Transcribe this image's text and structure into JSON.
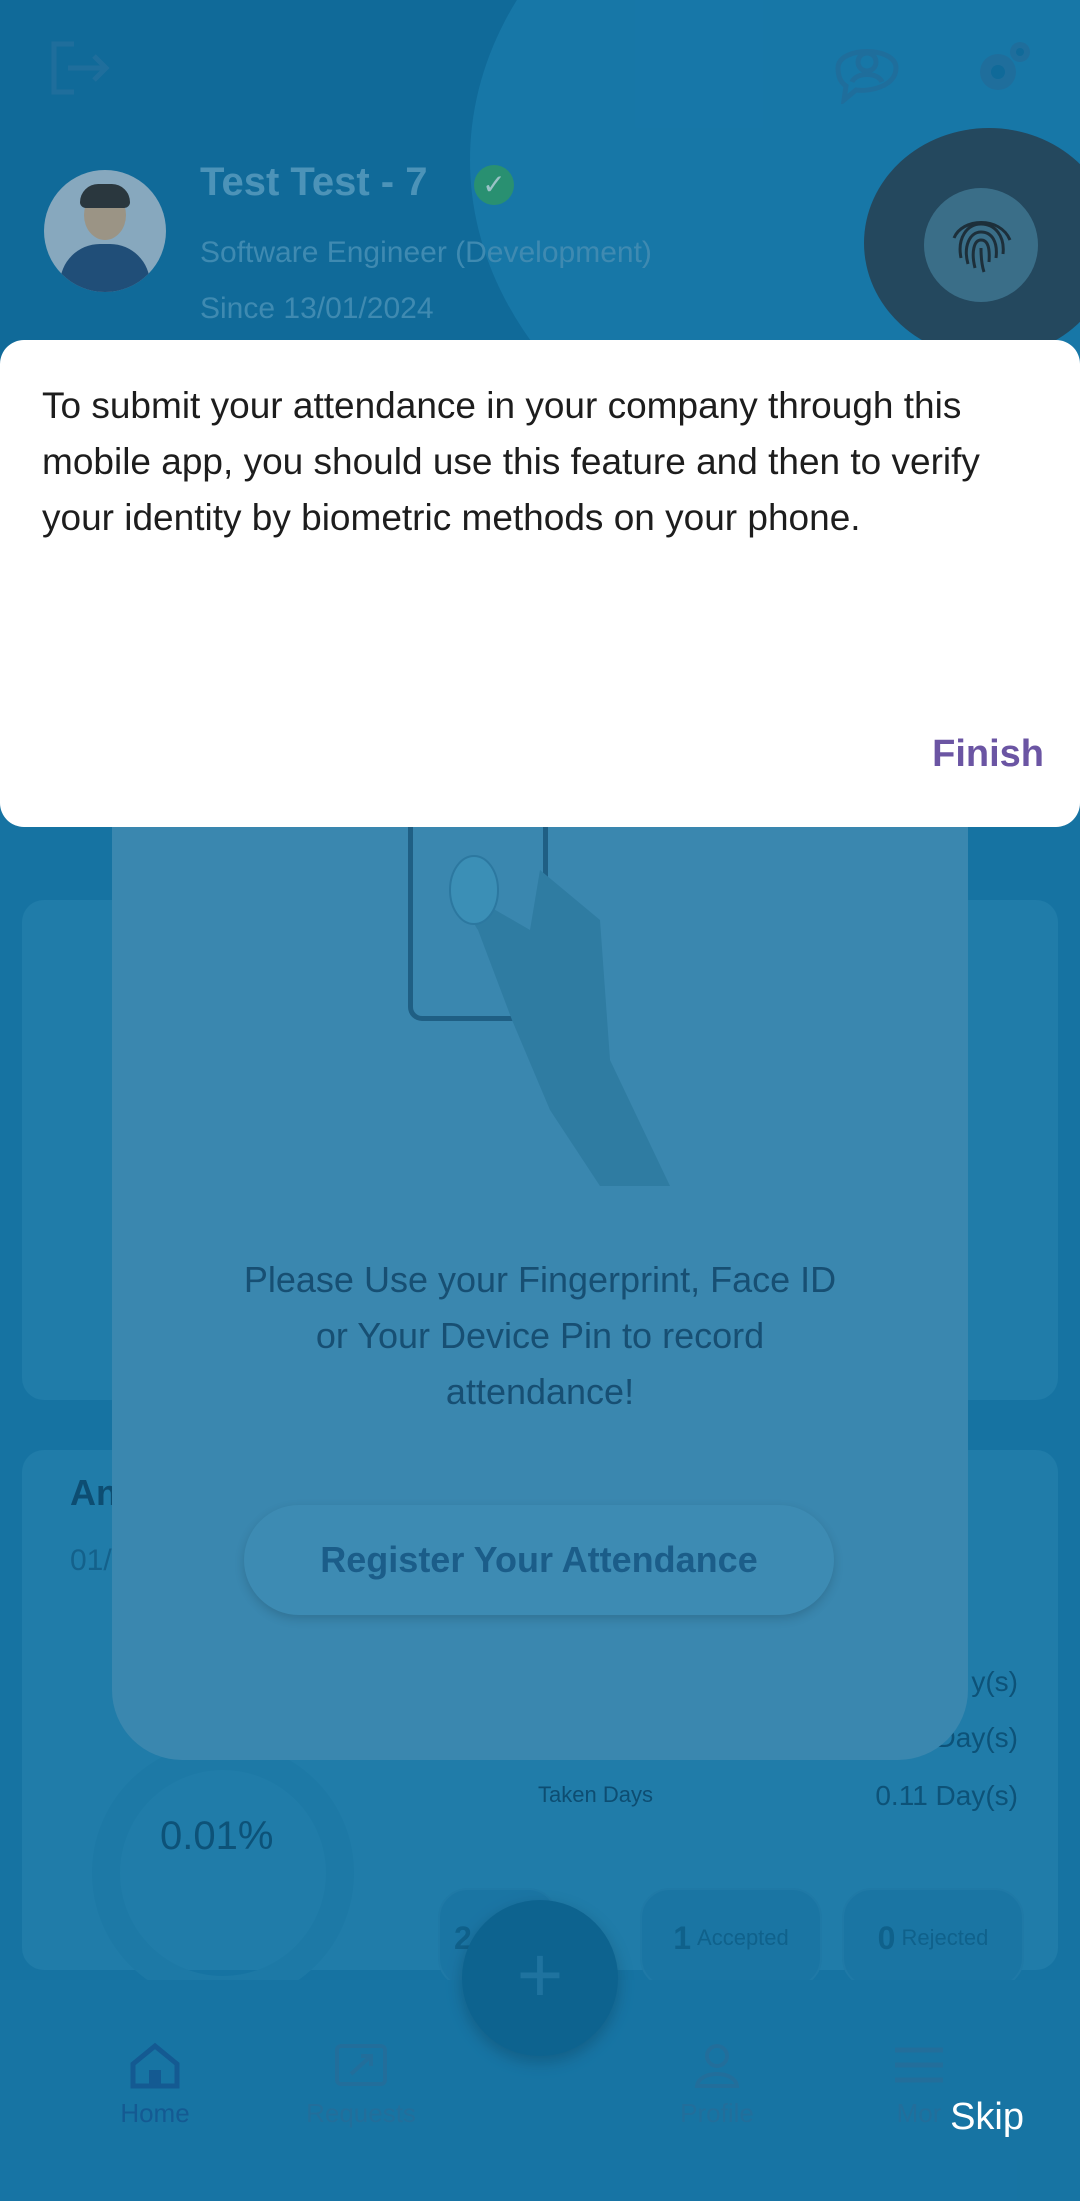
{
  "profile": {
    "name": "Test Test - 7",
    "title": "Software Engineer (Development)",
    "since": "Since 13/01/2024"
  },
  "annual": {
    "heading_partial": "An",
    "date_partial": "01/",
    "percent": "0.01%",
    "stats": [
      "y(s)",
      "Day(s)"
    ],
    "taken_label": "Taken Days",
    "taken_value": "0.11 Day(s)"
  },
  "requests": {
    "pending_partial": "2",
    "accepted_count": "1",
    "accepted_label": "Accepted",
    "rejected_count": "0",
    "rejected_label": "Rejected"
  },
  "biometric": {
    "instruction": "Please Use your Fingerprint, Face ID or Your Device Pin to record attendance!",
    "register_label": "Register Your Attendance"
  },
  "nav": {
    "home": "Home",
    "requests": "Requests",
    "profile": "Profile",
    "more_partial": "Mor"
  },
  "tutorial": {
    "message": "To submit your attendance in your company through this mobile app, you should use this feature and then to verify your identity by biometric methods on your phone.",
    "finish_label": "Finish",
    "skip_label": "Skip"
  },
  "colors": {
    "overlay": "#0b5f8a",
    "dialog_bg": "#ffffff",
    "finish": "#6b55a3",
    "skip": "#ffffff"
  },
  "icons": {
    "logout": "logout-icon",
    "assistant": "chat-person-icon",
    "settings": "gear-icon",
    "fingerprint": "fingerprint-icon",
    "verified": "check-icon"
  }
}
